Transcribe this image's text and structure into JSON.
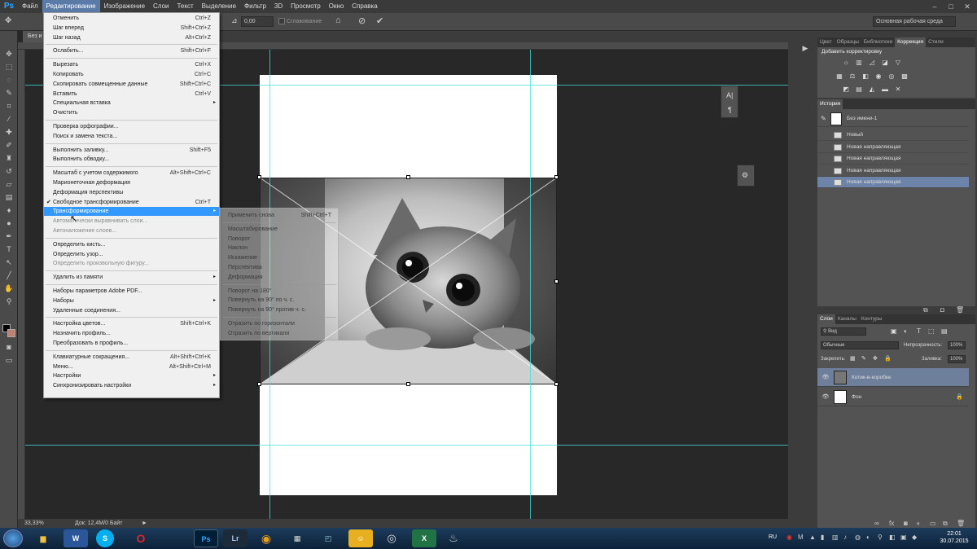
{
  "menubar": {
    "logo": "Ps",
    "items": [
      "Файл",
      "Редактирование",
      "Изображение",
      "Слои",
      "Текст",
      "Выделение",
      "Фильтр",
      "3D",
      "Просмотр",
      "Окно",
      "Справка"
    ],
    "window_controls": [
      "–",
      "□",
      "✕"
    ]
  },
  "options": {
    "angle_value": "0,00",
    "smoothing_label": "Сглаживание",
    "workspace": "Основная рабочая среда"
  },
  "document": {
    "tab_label": "Без и",
    "zoom": "33,33%",
    "doc_info": "Док: 12,4M/0 Байт",
    "scroll_arrow": "►"
  },
  "edit_menu": [
    {
      "label": "Отменить",
      "shortcut": "Ctrl+Z",
      "disabled": false
    },
    {
      "label": "Шаг вперед",
      "shortcut": "Shift+Ctrl+Z",
      "disabled": false
    },
    {
      "label": "Шаг назад",
      "shortcut": "Alt+Ctrl+Z",
      "disabled": false
    },
    {
      "sep": true
    },
    {
      "label": "Ослабить...",
      "shortcut": "Shift+Ctrl+F",
      "disabled": false
    },
    {
      "sep": true
    },
    {
      "label": "Вырезать",
      "shortcut": "Ctrl+X",
      "disabled": false
    },
    {
      "label": "Копировать",
      "shortcut": "Ctrl+C",
      "disabled": false
    },
    {
      "label": "Скопировать совмещенные данные",
      "shortcut": "Shift+Ctrl+C",
      "disabled": false
    },
    {
      "label": "Вставить",
      "shortcut": "Ctrl+V",
      "disabled": false
    },
    {
      "label": "Специальная вставка",
      "shortcut": "",
      "arrow": true,
      "disabled": false
    },
    {
      "label": "Очистить",
      "shortcut": "",
      "disabled": false
    },
    {
      "sep": true
    },
    {
      "label": "Проверка орфографии...",
      "shortcut": "",
      "disabled": false
    },
    {
      "label": "Поиск и замена текста...",
      "shortcut": "",
      "disabled": false
    },
    {
      "sep": true
    },
    {
      "label": "Выполнить заливку...",
      "shortcut": "Shift+F5",
      "disabled": false
    },
    {
      "label": "Выполнить обводку...",
      "shortcut": "",
      "disabled": false
    },
    {
      "sep": true
    },
    {
      "label": "Масштаб с учетом содержимого",
      "shortcut": "Alt+Shift+Ctrl+C",
      "disabled": false
    },
    {
      "label": "Марионеточная деформация",
      "shortcut": "",
      "disabled": false
    },
    {
      "label": "Деформация перспективы",
      "shortcut": "",
      "disabled": false
    },
    {
      "label": "Свободное трансформирование",
      "shortcut": "Ctrl+T",
      "check": true,
      "disabled": false
    },
    {
      "label": "Трансформирование",
      "shortcut": "",
      "arrow": true,
      "highlighted": true
    },
    {
      "label": "Автоматически выравнивать слои...",
      "shortcut": "",
      "disabled": true
    },
    {
      "label": "Автоналожение слоев...",
      "shortcut": "",
      "disabled": true
    },
    {
      "sep": true
    },
    {
      "label": "Определить кисть...",
      "shortcut": "",
      "disabled": false
    },
    {
      "label": "Определить узор...",
      "shortcut": "",
      "disabled": false
    },
    {
      "label": "Определить произвольную фигуру...",
      "shortcut": "",
      "disabled": true
    },
    {
      "sep": true
    },
    {
      "label": "Удалить из памяти",
      "shortcut": "",
      "arrow": true,
      "disabled": false
    },
    {
      "sep": true
    },
    {
      "label": "Наборы параметров Adobe PDF...",
      "shortcut": "",
      "disabled": false
    },
    {
      "label": "Наборы",
      "shortcut": "",
      "arrow": true,
      "disabled": false
    },
    {
      "label": "Удаленные соединения...",
      "shortcut": "",
      "disabled": false
    },
    {
      "sep": true
    },
    {
      "label": "Настройка цветов...",
      "shortcut": "Shift+Ctrl+K",
      "disabled": false
    },
    {
      "label": "Назначить профиль...",
      "shortcut": "",
      "disabled": false
    },
    {
      "label": "Преобразовать в профиль...",
      "shortcut": "",
      "disabled": false
    },
    {
      "sep": true
    },
    {
      "label": "Клавиатурные сокращения...",
      "shortcut": "Alt+Shift+Ctrl+K",
      "disabled": false
    },
    {
      "label": "Меню...",
      "shortcut": "Alt+Shift+Ctrl+M",
      "disabled": false
    },
    {
      "label": "Настройки",
      "shortcut": "",
      "arrow": true,
      "disabled": false
    },
    {
      "label": "Синхронизировать настройки",
      "shortcut": "",
      "arrow": true,
      "disabled": false
    }
  ],
  "transform_submenu": [
    {
      "label": "Применить снова",
      "shortcut": "Shift+Ctrl+T"
    },
    {
      "sep": true
    },
    {
      "label": "Масштабирование",
      "shortcut": ""
    },
    {
      "label": "Поворот",
      "shortcut": ""
    },
    {
      "label": "Наклон",
      "shortcut": ""
    },
    {
      "label": "Искажение",
      "shortcut": ""
    },
    {
      "label": "Перспектива",
      "shortcut": ""
    },
    {
      "label": "Деформация",
      "shortcut": ""
    },
    {
      "sep": true
    },
    {
      "label": "Поворот на 180°",
      "shortcut": ""
    },
    {
      "label": "Повернуть на 90° по ч. с.",
      "shortcut": ""
    },
    {
      "label": "Повернуть на 90° против ч. с.",
      "shortcut": ""
    },
    {
      "sep": true
    },
    {
      "label": "Отразить по горизонтали",
      "shortcut": ""
    },
    {
      "label": "Отразить по вертикали",
      "shortcut": ""
    }
  ],
  "right_panels": {
    "top_tabs": [
      "Цвет",
      "Образцы",
      "Библиотеки",
      "Коррекция",
      "Стили"
    ],
    "active_top_tab": "Коррекция",
    "adjust_title": "Добавить корректировку",
    "history_tab": "История",
    "history_snapshot": "Без имени-1",
    "history_items": [
      "Новый",
      "Новая направляющая",
      "Новая направляющая",
      "Новая направляющая",
      "Новая направляющая"
    ],
    "layers_tabs": [
      "Слои",
      "Каналы",
      "Контуры"
    ],
    "kind_filter": "Вид",
    "blend_mode": "Обычные",
    "opacity_label": "Непрозрачность:",
    "opacity_value": "100%",
    "lock_label": "Закрепить:",
    "fill_label": "Заливка:",
    "fill_value": "100%",
    "layers": [
      {
        "name": "Котик-в-коробке",
        "selected": true
      },
      {
        "name": "Фон",
        "selected": false
      }
    ]
  },
  "taskbar": {
    "apps": [
      "W",
      "S",
      "O",
      "Ps",
      "Lr",
      "◉",
      "▦",
      "◰",
      "☺",
      "◎",
      "X",
      "♨"
    ],
    "lang": "RU",
    "time": "22:01",
    "date": "30.07.2015"
  },
  "colors": {
    "menu_highlight": "#3399ff",
    "guide": "#3fe0e0",
    "panel": "#535353",
    "selection": "#6e7f9c"
  }
}
